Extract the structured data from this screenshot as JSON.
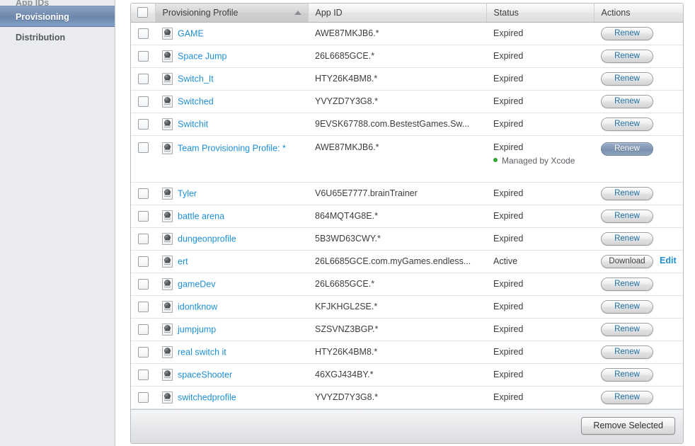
{
  "sidebar": {
    "items": [
      {
        "label": "App IDs",
        "selected": false,
        "clipped": true
      },
      {
        "label": "Provisioning",
        "selected": true,
        "clipped": false
      },
      {
        "label": "Distribution",
        "selected": false,
        "clipped": false
      }
    ]
  },
  "table": {
    "columns": [
      {
        "key": "checkbox",
        "label": ""
      },
      {
        "key": "name",
        "label": "Provisioning Profile",
        "sorted": true,
        "sort_direction": "ascending"
      },
      {
        "key": "appid",
        "label": "App ID"
      },
      {
        "key": "status",
        "label": "Status"
      },
      {
        "key": "actions",
        "label": "Actions"
      }
    ],
    "rows": [
      {
        "name": "GAME",
        "appid": "AWE87MKJB6.*",
        "status": "Expired",
        "action": "Renew",
        "action_style": "normal",
        "managed": null,
        "tall": false,
        "edit": null
      },
      {
        "name": "Space Jump",
        "appid": "26L6685GCE.*",
        "status": "Expired",
        "action": "Renew",
        "action_style": "normal",
        "managed": null,
        "tall": false,
        "edit": null
      },
      {
        "name": "Switch_It",
        "appid": "HTY26K4BM8.*",
        "status": "Expired",
        "action": "Renew",
        "action_style": "normal",
        "managed": null,
        "tall": false,
        "edit": null
      },
      {
        "name": "Switched",
        "appid": "YVYZD7Y3G8.*",
        "status": "Expired",
        "action": "Renew",
        "action_style": "normal",
        "managed": null,
        "tall": false,
        "edit": null
      },
      {
        "name": "Switchit",
        "appid": "9EVSK67788.com.BestestGames.Sw...",
        "status": "Expired",
        "action": "Renew",
        "action_style": "normal",
        "managed": null,
        "tall": false,
        "edit": null
      },
      {
        "name": "Team Provisioning Profile: *",
        "appid": "AWE87MKJB6.*",
        "status": "Expired",
        "action": "Renew",
        "action_style": "active",
        "managed": "Managed by Xcode",
        "tall": true,
        "edit": null
      },
      {
        "name": "Tyler",
        "appid": "V6U65E7777.brainTrainer",
        "status": "Expired",
        "action": "Renew",
        "action_style": "normal",
        "managed": null,
        "tall": false,
        "edit": null
      },
      {
        "name": "battle arena",
        "appid": "864MQT4G8E.*",
        "status": "Expired",
        "action": "Renew",
        "action_style": "normal",
        "managed": null,
        "tall": false,
        "edit": null
      },
      {
        "name": "dungeonprofile",
        "appid": "5B3WD63CWY.*",
        "status": "Expired",
        "action": "Renew",
        "action_style": "normal",
        "managed": null,
        "tall": false,
        "edit": null
      },
      {
        "name": "ert",
        "appid": "26L6685GCE.com.myGames.endless...",
        "status": "Active",
        "action": "Download",
        "action_style": "download",
        "managed": null,
        "tall": false,
        "edit": "Edit"
      },
      {
        "name": "gameDev",
        "appid": "26L6685GCE.*",
        "status": "Expired",
        "action": "Renew",
        "action_style": "normal",
        "managed": null,
        "tall": false,
        "edit": null
      },
      {
        "name": "idontknow",
        "appid": "KFJKHGL2SE.*",
        "status": "Expired",
        "action": "Renew",
        "action_style": "normal",
        "managed": null,
        "tall": false,
        "edit": null
      },
      {
        "name": "jumpjump",
        "appid": "SZSVNZ3BGP.*",
        "status": "Expired",
        "action": "Renew",
        "action_style": "normal",
        "managed": null,
        "tall": false,
        "edit": null
      },
      {
        "name": "real switch it",
        "appid": "HTY26K4BM8.*",
        "status": "Expired",
        "action": "Renew",
        "action_style": "normal",
        "managed": null,
        "tall": false,
        "edit": null
      },
      {
        "name": "spaceShooter",
        "appid": "46XGJ434BY.*",
        "status": "Expired",
        "action": "Renew",
        "action_style": "normal",
        "managed": null,
        "tall": false,
        "edit": null
      },
      {
        "name": "switchedprofile",
        "appid": "YVYZD7Y3G8.*",
        "status": "Expired",
        "action": "Renew",
        "action_style": "normal",
        "managed": null,
        "tall": false,
        "edit": null
      }
    ]
  },
  "footer": {
    "remove_selected_label": "Remove Selected"
  },
  "colors": {
    "link": "#1f8ed1",
    "selected_nav": "#7089ad",
    "managed_dot": "#2faa2f"
  },
  "icons": {
    "profile": "provisioning-profile-icon",
    "sort": "sort-ascending-icon",
    "checkbox": "checkbox-icon"
  }
}
